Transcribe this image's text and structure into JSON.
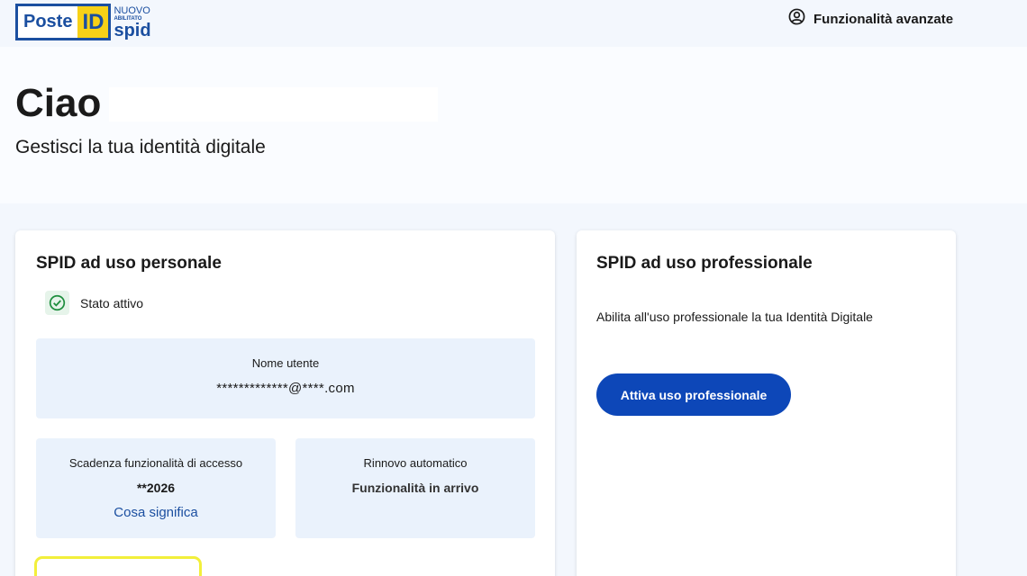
{
  "header": {
    "logo": {
      "poste": "Poste",
      "id": "ID",
      "nuovo": "NUOVO",
      "abilitato": "ABILITATO",
      "spid": "spid"
    },
    "advanced_link": "Funzionalità avanzate",
    "advanced_icon": "user-circle-icon"
  },
  "hero": {
    "greeting": "Ciao",
    "subtitle": "Gestisci la tua identità digitale"
  },
  "personal": {
    "title": "SPID ad uso personale",
    "status": "Stato attivo",
    "status_icon": "check-circle-icon",
    "status_color": "#1e8e3e",
    "username_label": "Nome utente",
    "username_value": "*************@****.com",
    "expiry_label": "Scadenza funzionalità di accesso",
    "expiry_value": "**2026",
    "expiry_link": "Cosa significa",
    "renewal_label": "Rinnovo automatico",
    "renewal_value": "Funzionalità in arrivo"
  },
  "professional": {
    "title": "SPID ad uso professionale",
    "description": "Abilita all'uso professionale la tua Identità Digitale",
    "button": "Attiva uso professionale",
    "button_color": "#0d47b8"
  },
  "colors": {
    "accent": "#1b4fa0",
    "panel": "#eaf2fc",
    "highlight": "#f2ef3b"
  }
}
